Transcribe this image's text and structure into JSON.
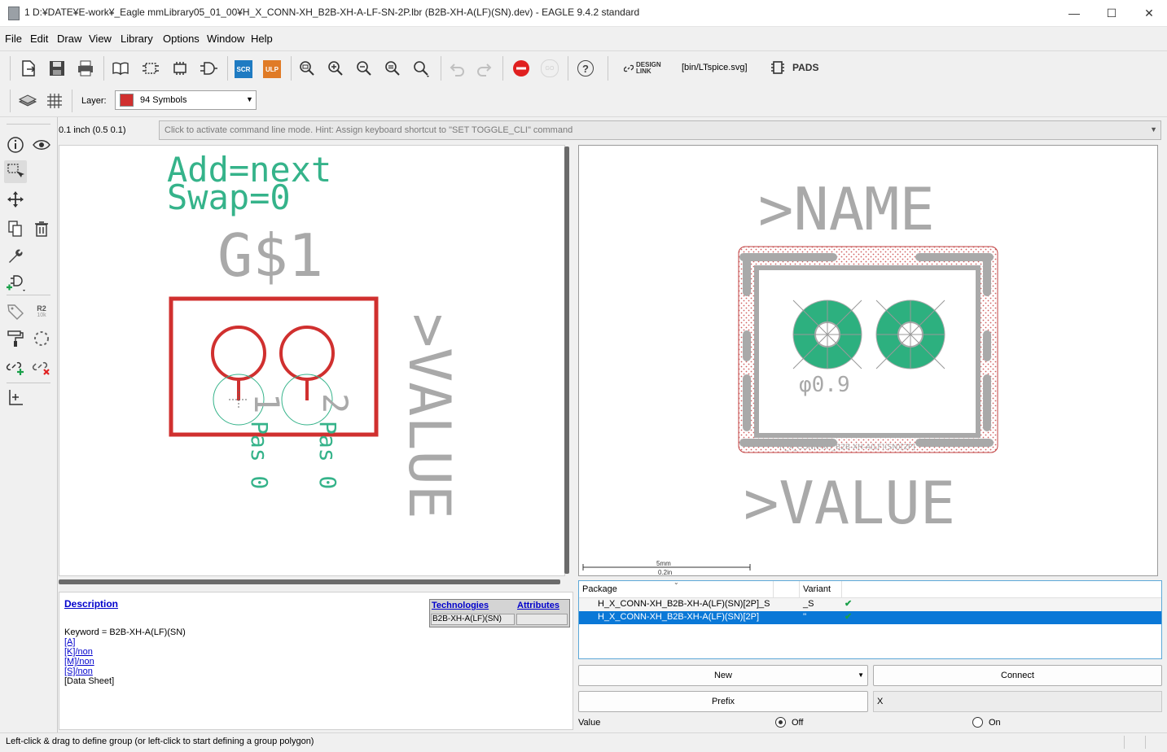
{
  "window": {
    "title": "1 D:¥DATE¥E-work¥_Eagle mmLibrary05_01_00¥H_X_CONN-XH_B2B-XH-A-LF-SN-2P.lbr (B2B-XH-A(LF)(SN).dev) - EAGLE 9.4.2 standard",
    "minimize": "—",
    "maximize": "☐",
    "close": "✕"
  },
  "menu": [
    "File",
    "Edit",
    "Draw",
    "View",
    "Library",
    "Options",
    "Window",
    "Help"
  ],
  "toolbar": {
    "scr": "SCR",
    "ulp": "ULP",
    "go": "GO",
    "help": "?",
    "design_link_1": "DESIGN",
    "design_link_2": "LINK",
    "ulp_path": "[bin/LTspice.svg]",
    "pads": "PADS",
    "layer_label": "Layer:",
    "layer_value": "94 Symbols",
    "layer_color": "#d0302f"
  },
  "tools": {
    "r2_label": "R2",
    "r2_sub": "10k"
  },
  "coords": "0.1 inch (0.5 0.1)",
  "command_line": "Click to activate command line mode. Hint: Assign keyboard shortcut to \"SET TOGGLE_CLI\" command",
  "symbol": {
    "add": "Add=next",
    "swap": "Swap=0",
    "gate": "G$1",
    "value": ">VALUE",
    "pin1": "1",
    "pin2": "2",
    "pin_label": "Pas 0",
    "gate_color": "#d0302f",
    "text_color": "#35b38a"
  },
  "package": {
    "name": ">NAME",
    "value": ">VALUE",
    "hole": "φ0.9",
    "device_text": "H_X_CONN-XH_B2B-XH-A(LF)(SN)[2P]",
    "scale_top": "5mm",
    "scale_bottom": "0.2in",
    "pad_color": "#2db07f"
  },
  "description": {
    "title": "Description",
    "keyword": "Keyword = B2B-XH-A(LF)(SN)",
    "links": [
      "[A]",
      "[K]/non",
      "[M]/non",
      "[S]/non"
    ],
    "datasheet": "[Data Sheet]",
    "technologies_header": "Technologies",
    "attributes_header": "Attributes",
    "technology_value": "B2B-XH-A(LF)(SN)"
  },
  "package_table": {
    "headers": [
      "Package",
      "Variant"
    ],
    "rows": [
      {
        "package": "H_X_CONN-XH_B2B-XH-A(LF)(SN)[2P]_S",
        "variant": "_S",
        "check": "✔"
      },
      {
        "package": "H_X_CONN-XH_B2B-XH-A(LF)(SN)[2P]",
        "variant": "''",
        "check": "✔"
      }
    ]
  },
  "buttons": {
    "new": "New",
    "connect": "Connect",
    "prefix": "Prefix",
    "prefix_value": "X"
  },
  "value_options": {
    "label": "Value",
    "off": "Off",
    "on": "On"
  },
  "status": "Left-click & drag to define group (or left-click to start defining a group polygon)"
}
